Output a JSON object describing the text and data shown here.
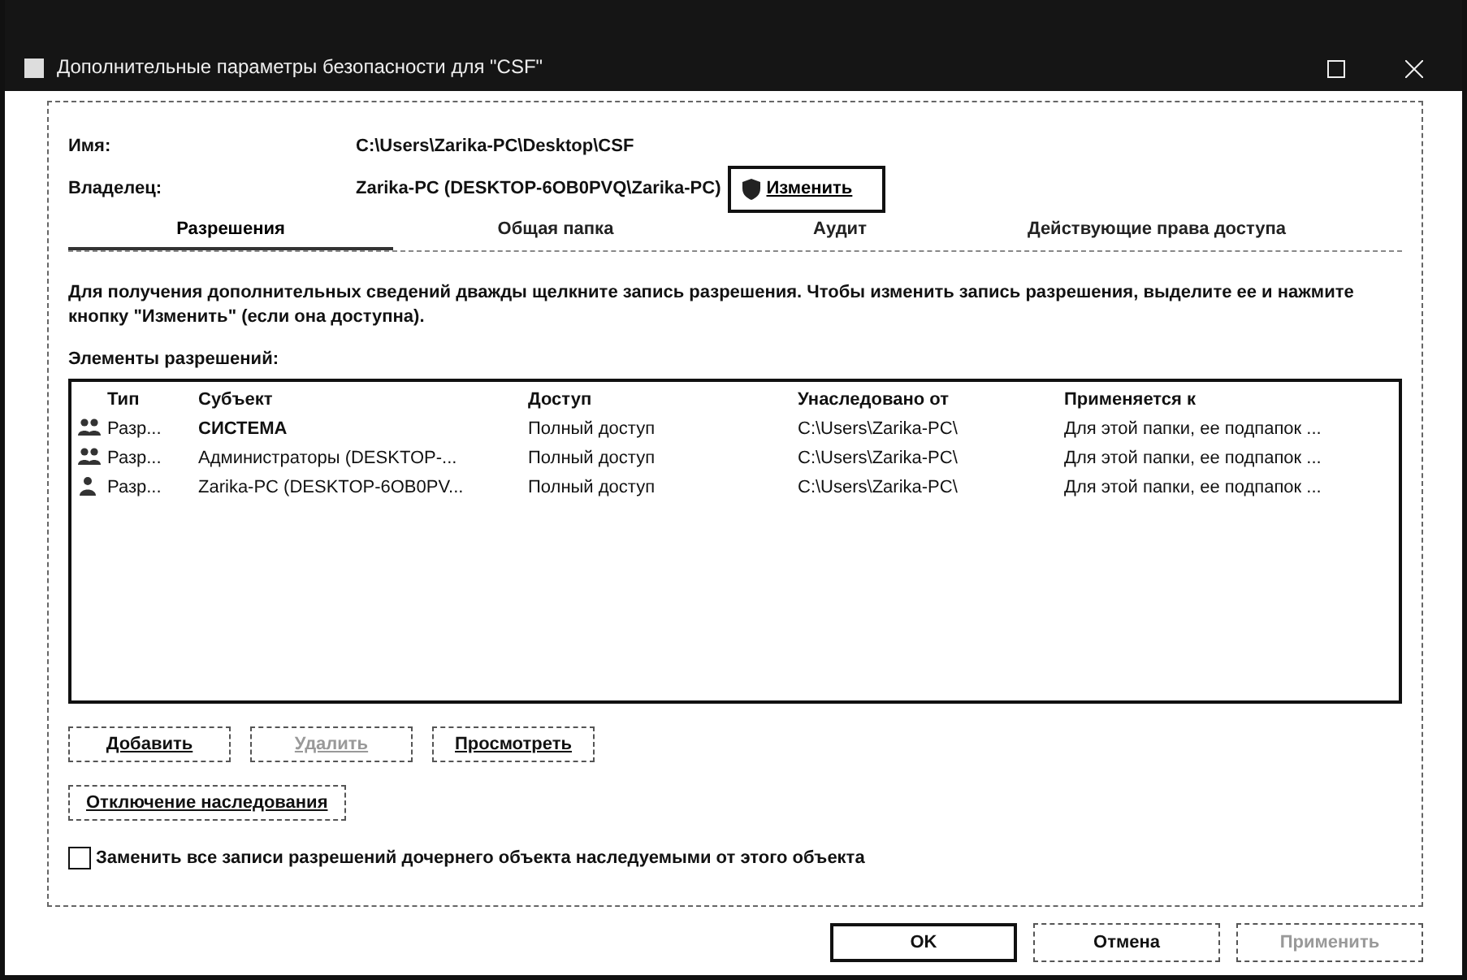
{
  "window": {
    "title": "Дополнительные параметры безопасности  для \"CSF\""
  },
  "fields": [
    {
      "label": "Имя:",
      "value": "C:\\Users\\Zarika-PC\\Desktop\\CSF"
    },
    {
      "label": "Владелец:",
      "value": "Zarika-PC (DESKTOP-6OB0PVQ\\Zarika-PC)",
      "button": "Изменить"
    }
  ],
  "tabs": [
    {
      "label": "Разрешения",
      "selected": true
    },
    {
      "label": "Общая папка",
      "selected": false
    },
    {
      "label": "Аудит",
      "selected": false
    },
    {
      "label": "Действующие права доступа",
      "selected": false
    }
  ],
  "info": "Для получения дополнительных сведений дважды щелкните запись разрешения. Чтобы изменить запись разрешения, выделите ее и нажмите кнопку \"Изменить\" (если она доступна).",
  "table": {
    "title": "Элементы разрешений:",
    "columns": [
      "Тип",
      "Субъект",
      "Доступ",
      "Унаследовано от",
      "Применяется к"
    ],
    "rows": [
      {
        "kind": "group",
        "cells": [
          "Разр...",
          "СИСТЕМА",
          "Полный доступ",
          "C:\\Users\\Zarika-PC\\",
          "Для этой папки, ее подпапок ..."
        ]
      },
      {
        "kind": "group",
        "cells": [
          "Разр...",
          "Администраторы (DESKTOP-...",
          "Полный доступ",
          "C:\\Users\\Zarika-PC\\",
          "Для этой папки, ее подпапок ..."
        ]
      },
      {
        "kind": "user",
        "cells": [
          "Разр...",
          "Zarika-PC (DESKTOP-6OB0PV...",
          "Полный доступ",
          "C:\\Users\\Zarika-PC\\",
          "Для этой папки, ее подпапок ..."
        ]
      }
    ]
  },
  "entry_buttons": [
    {
      "label": "Добавить",
      "disabled": false
    },
    {
      "label": "Удалить",
      "disabled": true
    },
    {
      "label": "Просмотреть",
      "disabled": false
    }
  ],
  "inheritance_button": {
    "label": "Отключение наследования"
  },
  "replace_checkbox": {
    "label": "Заменить все записи разрешений дочернего объекта наследуемыми от этого объекта",
    "checked": false
  },
  "dialog_buttons": [
    {
      "label": "OK",
      "disabled": false
    },
    {
      "label": "Отмена",
      "disabled": false
    },
    {
      "label": "Применить",
      "disabled": true
    }
  ]
}
